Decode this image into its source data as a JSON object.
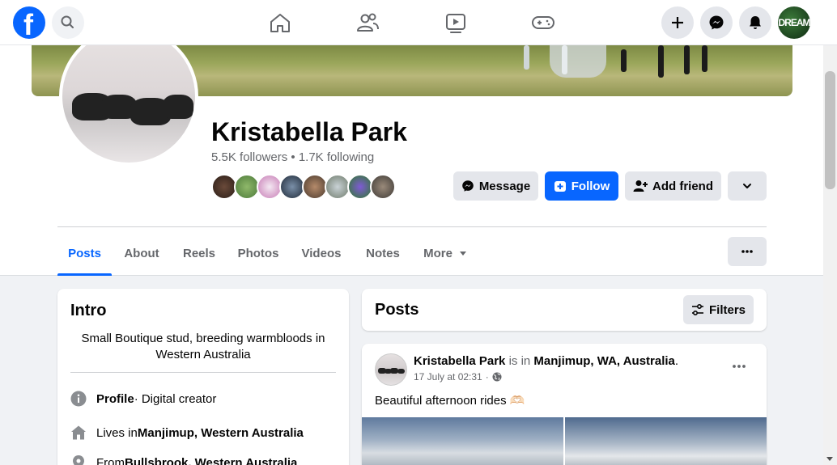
{
  "topbar": {
    "logo": "f",
    "avatar_text": "DREAM",
    "nav_icons": [
      "home-icon",
      "friends-icon",
      "watch-icon",
      "gaming-icon"
    ],
    "right_icons": [
      "plus-icon",
      "messenger-icon",
      "bell-icon"
    ]
  },
  "profile": {
    "name": "Kristabella Park",
    "followers": "5.5K followers",
    "separator": " • ",
    "following": "1.7K following"
  },
  "actions": {
    "message": "Message",
    "follow": "Follow",
    "add_friend": "Add friend"
  },
  "tabs": [
    "Posts",
    "About",
    "Reels",
    "Photos",
    "Videos",
    "Notes",
    "More"
  ],
  "active_tab": "Posts",
  "intro": {
    "title": "Intro",
    "bio": "Small Boutique stud, breeding warmbloods in Western Australia",
    "profile_label": "Profile",
    "profile_type": " · Digital creator",
    "lives_prefix": "Lives in ",
    "lives_place": "Manjimup, Western Australia",
    "from_prefix": "From ",
    "from_place": "Bullsbrook, Western Australia"
  },
  "posts_header": {
    "title": "Posts",
    "filters": "Filters"
  },
  "post": {
    "author": "Kristabella Park",
    "is_in": " is in ",
    "location": "Manjimup, WA, Australia",
    "period": ".",
    "time": "17 July at 02:31",
    "dot": "·",
    "text": "Beautiful afternoon rides 🫶🏻"
  },
  "colors": {
    "accent": "#0866ff",
    "muted": "#65676b",
    "background": "#f0f2f5"
  }
}
